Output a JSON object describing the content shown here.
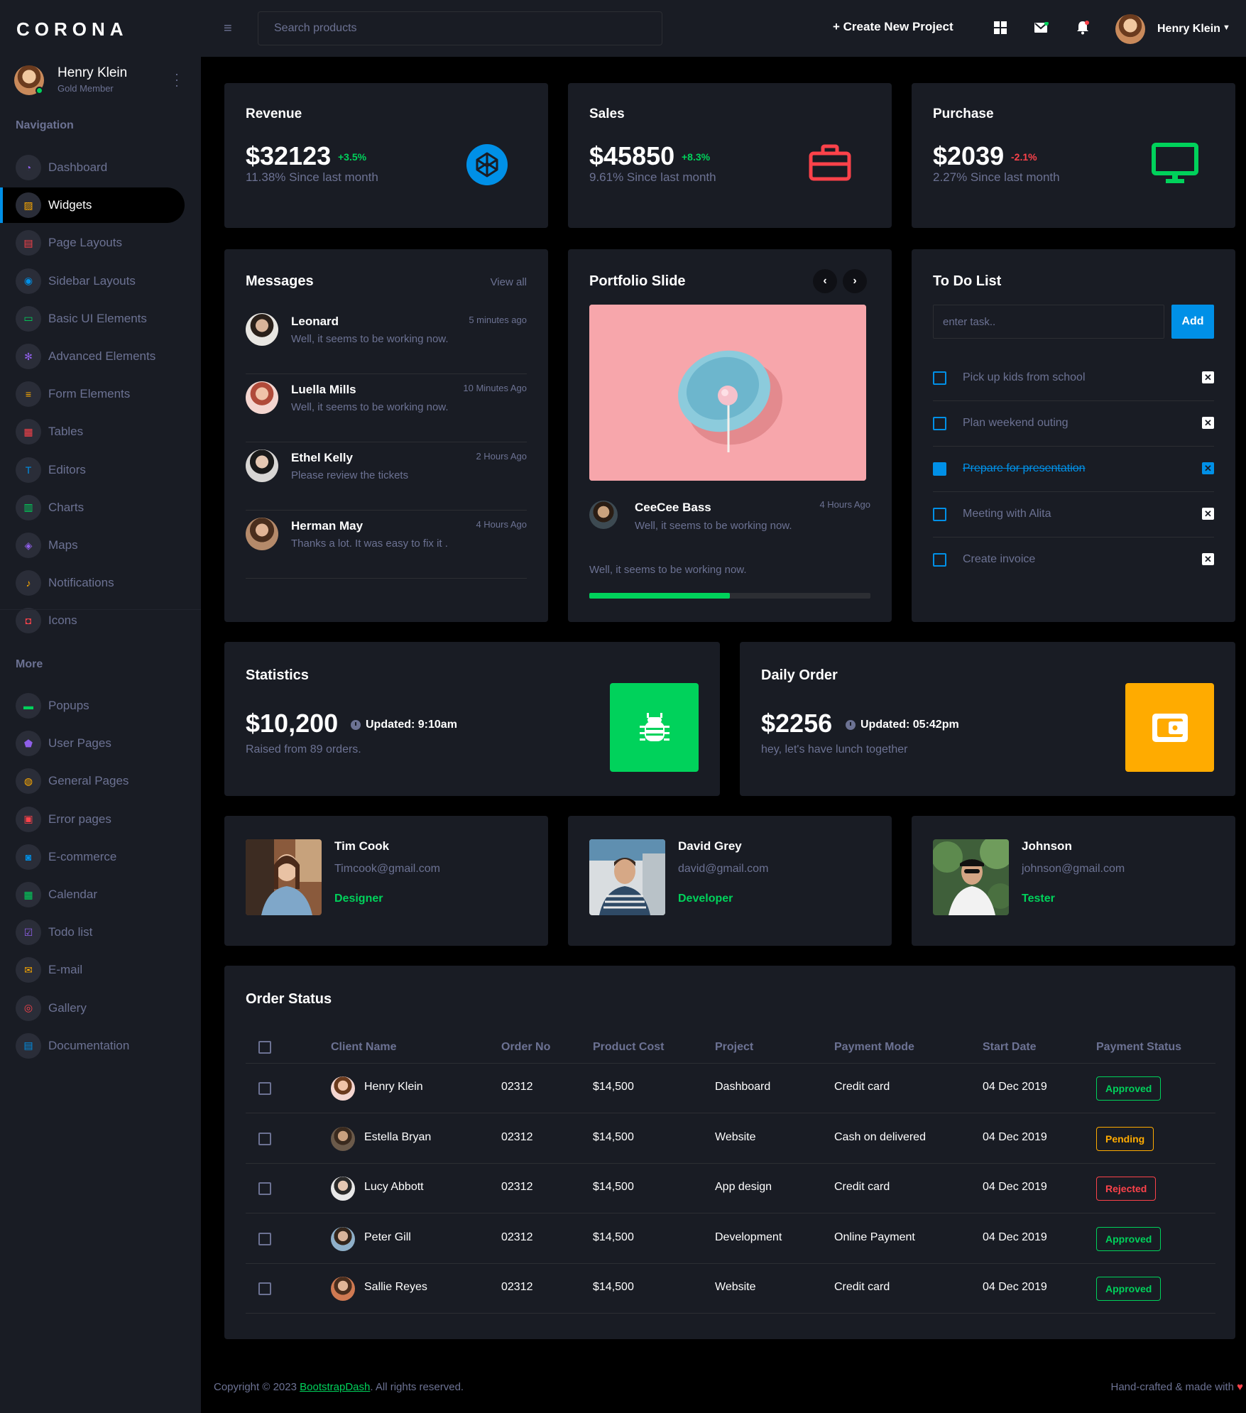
{
  "brand": "CORONA",
  "profile": {
    "name": "Henry Klein",
    "role": "Gold Member"
  },
  "sidebar": {
    "nav_heading": "Navigation",
    "more_heading": "More",
    "nav_items": [
      {
        "label": "Dashboard",
        "icon": "speedometer-icon",
        "color": "#8f5fe8"
      },
      {
        "label": "Widgets",
        "icon": "widgets-icon",
        "color": "#ffab00"
      },
      {
        "label": "Page Layouts",
        "icon": "layouts-icon",
        "color": "#fc424a"
      },
      {
        "label": "Sidebar Layouts",
        "icon": "sidebar-layouts-icon",
        "color": "#0090e7"
      },
      {
        "label": "Basic UI Elements",
        "icon": "laptop-icon",
        "color": "#00d25b"
      },
      {
        "label": "Advanced Elements",
        "icon": "cog-icon",
        "color": "#8f5fe8"
      },
      {
        "label": "Form Elements",
        "icon": "form-icon",
        "color": "#ffab00"
      },
      {
        "label": "Tables",
        "icon": "table-icon",
        "color": "#fc424a"
      },
      {
        "label": "Editors",
        "icon": "text-editor-icon",
        "color": "#0090e7"
      },
      {
        "label": "Charts",
        "icon": "chart-icon",
        "color": "#00d25b"
      },
      {
        "label": "Maps",
        "icon": "map-marker-icon",
        "color": "#8f5fe8"
      },
      {
        "label": "Notifications",
        "icon": "bell-icon",
        "color": "#ffab00"
      },
      {
        "label": "Icons",
        "icon": "icons-icon",
        "color": "#fc424a"
      }
    ],
    "more_items": [
      {
        "label": "Popups",
        "icon": "popup-icon",
        "color": "#00d25b"
      },
      {
        "label": "User Pages",
        "icon": "shield-icon",
        "color": "#8f5fe8"
      },
      {
        "label": "General Pages",
        "icon": "globe-icon",
        "color": "#ffab00"
      },
      {
        "label": "Error pages",
        "icon": "lock-icon",
        "color": "#fc424a"
      },
      {
        "label": "E-commerce",
        "icon": "shopping-bag-icon",
        "color": "#0090e7"
      },
      {
        "label": "Calendar",
        "icon": "calendar-icon",
        "color": "#00d25b"
      },
      {
        "label": "Todo list",
        "icon": "checklist-icon",
        "color": "#8f5fe8"
      },
      {
        "label": "E-mail",
        "icon": "envelope-icon",
        "color": "#ffab00"
      },
      {
        "label": "Gallery",
        "icon": "image-icon",
        "color": "#fc424a"
      },
      {
        "label": "Documentation",
        "icon": "document-icon",
        "color": "#0090e7"
      }
    ],
    "active": "Widgets"
  },
  "topbar": {
    "search_placeholder": "Search products",
    "create_project": "+ Create New Project",
    "user_name": "Henry Klein"
  },
  "stats": [
    {
      "title": "Revenue",
      "value": "$32123",
      "delta": "+3.5%",
      "trend": "up",
      "sub": "11.38% Since last month",
      "icon": "codepen-icon",
      "color": "#0090e7"
    },
    {
      "title": "Sales",
      "value": "$45850",
      "delta": "+8.3%",
      "trend": "up",
      "sub": "9.61% Since last month",
      "icon": "briefcase-icon",
      "color": "#fc424a"
    },
    {
      "title": "Purchase",
      "value": "$2039",
      "delta": "-2.1%",
      "trend": "down",
      "sub": "2.27% Since last month",
      "icon": "monitor-icon",
      "color": "#00d25b"
    }
  ],
  "messages": {
    "title": "Messages",
    "view_all": "View all",
    "items": [
      {
        "name": "Leonard",
        "text": "Well, it seems to be working now.",
        "time": "5 minutes ago"
      },
      {
        "name": "Luella Mills",
        "text": "Well, it seems to be working now.",
        "time": "10 Minutes Ago"
      },
      {
        "name": "Ethel Kelly",
        "text": "Please review the tickets",
        "time": "2 Hours Ago"
      },
      {
        "name": "Herman May",
        "text": "Thanks a lot. It was easy to fix it .",
        "time": "4 Hours Ago"
      }
    ]
  },
  "portfolio": {
    "title": "Portfolio Slide",
    "author": "CeeCee Bass",
    "author_text": "Well, it seems to be working now.",
    "time": "4 Hours Ago",
    "caption": "Well, it seems to be working now.",
    "progress": 0.5
  },
  "todo": {
    "title": "To Do List",
    "placeholder": "enter task..",
    "add_label": "Add",
    "items": [
      {
        "label": "Pick up kids from school",
        "done": false
      },
      {
        "label": "Plan weekend outing",
        "done": false
      },
      {
        "label": "Prepare for presentation",
        "done": true
      },
      {
        "label": "Meeting with Alita",
        "done": false
      },
      {
        "label": "Create invoice",
        "done": false
      }
    ]
  },
  "statistics": {
    "title": "Statistics",
    "value": "$10,200",
    "updated": "Updated: 9:10am",
    "sub": "Raised from 89 orders.",
    "icon": "bug-icon",
    "color": "#00d25b"
  },
  "daily_order": {
    "title": "Daily Order",
    "value": "$2256",
    "updated": "Updated: 05:42pm",
    "sub": "hey, let's have lunch together",
    "icon": "wallet-icon",
    "color": "#ffab00"
  },
  "people": [
    {
      "name": "Tim Cook",
      "email": "Timcook@gmail.com",
      "role": "Designer"
    },
    {
      "name": "David Grey",
      "email": "david@gmail.com",
      "role": "Developer"
    },
    {
      "name": "Johnson",
      "email": "johnson@gmail.com",
      "role": "Tester"
    }
  ],
  "orders": {
    "title": "Order Status",
    "columns": [
      "Client Name",
      "Order No",
      "Product Cost",
      "Project",
      "Payment Mode",
      "Start Date",
      "Payment Status"
    ],
    "rows": [
      {
        "client": "Henry Klein",
        "order_no": "02312",
        "cost": "$14,500",
        "project": "Dashboard",
        "mode": "Credit card",
        "date": "04 Dec 2019",
        "status": "Approved",
        "status_type": "approved"
      },
      {
        "client": "Estella Bryan",
        "order_no": "02312",
        "cost": "$14,500",
        "project": "Website",
        "mode": "Cash on delivered",
        "date": "04 Dec 2019",
        "status": "Pending",
        "status_type": "pending"
      },
      {
        "client": "Lucy Abbott",
        "order_no": "02312",
        "cost": "$14,500",
        "project": "App design",
        "mode": "Credit card",
        "date": "04 Dec 2019",
        "status": "Rejected",
        "status_type": "rejected"
      },
      {
        "client": "Peter Gill",
        "order_no": "02312",
        "cost": "$14,500",
        "project": "Development",
        "mode": "Online Payment",
        "date": "04 Dec 2019",
        "status": "Approved",
        "status_type": "approved"
      },
      {
        "client": "Sallie Reyes",
        "order_no": "02312",
        "cost": "$14,500",
        "project": "Website",
        "mode": "Credit card",
        "date": "04 Dec 2019",
        "status": "Approved",
        "status_type": "approved"
      }
    ]
  },
  "footer": {
    "copyright_prefix": "Copyright © 2023 ",
    "copyright_link": "BootstrapDash",
    "copyright_suffix": ". All rights reserved.",
    "right": "Hand-crafted & made with"
  }
}
